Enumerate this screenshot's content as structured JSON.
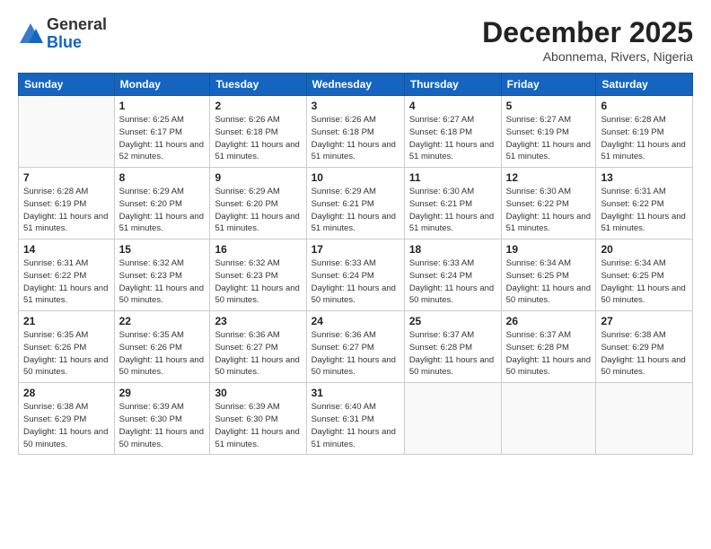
{
  "logo": {
    "general": "General",
    "blue": "Blue"
  },
  "title": "December 2025",
  "subtitle": "Abonnema, Rivers, Nigeria",
  "days_of_week": [
    "Sunday",
    "Monday",
    "Tuesday",
    "Wednesday",
    "Thursday",
    "Friday",
    "Saturday"
  ],
  "weeks": [
    [
      {
        "day": "",
        "sunrise": "",
        "sunset": "",
        "daylight": ""
      },
      {
        "day": "1",
        "sunrise": "Sunrise: 6:25 AM",
        "sunset": "Sunset: 6:17 PM",
        "daylight": "Daylight: 11 hours and 52 minutes."
      },
      {
        "day": "2",
        "sunrise": "Sunrise: 6:26 AM",
        "sunset": "Sunset: 6:18 PM",
        "daylight": "Daylight: 11 hours and 51 minutes."
      },
      {
        "day": "3",
        "sunrise": "Sunrise: 6:26 AM",
        "sunset": "Sunset: 6:18 PM",
        "daylight": "Daylight: 11 hours and 51 minutes."
      },
      {
        "day": "4",
        "sunrise": "Sunrise: 6:27 AM",
        "sunset": "Sunset: 6:18 PM",
        "daylight": "Daylight: 11 hours and 51 minutes."
      },
      {
        "day": "5",
        "sunrise": "Sunrise: 6:27 AM",
        "sunset": "Sunset: 6:19 PM",
        "daylight": "Daylight: 11 hours and 51 minutes."
      },
      {
        "day": "6",
        "sunrise": "Sunrise: 6:28 AM",
        "sunset": "Sunset: 6:19 PM",
        "daylight": "Daylight: 11 hours and 51 minutes."
      }
    ],
    [
      {
        "day": "7",
        "sunrise": "Sunrise: 6:28 AM",
        "sunset": "Sunset: 6:19 PM",
        "daylight": "Daylight: 11 hours and 51 minutes."
      },
      {
        "day": "8",
        "sunrise": "Sunrise: 6:29 AM",
        "sunset": "Sunset: 6:20 PM",
        "daylight": "Daylight: 11 hours and 51 minutes."
      },
      {
        "day": "9",
        "sunrise": "Sunrise: 6:29 AM",
        "sunset": "Sunset: 6:20 PM",
        "daylight": "Daylight: 11 hours and 51 minutes."
      },
      {
        "day": "10",
        "sunrise": "Sunrise: 6:29 AM",
        "sunset": "Sunset: 6:21 PM",
        "daylight": "Daylight: 11 hours and 51 minutes."
      },
      {
        "day": "11",
        "sunrise": "Sunrise: 6:30 AM",
        "sunset": "Sunset: 6:21 PM",
        "daylight": "Daylight: 11 hours and 51 minutes."
      },
      {
        "day": "12",
        "sunrise": "Sunrise: 6:30 AM",
        "sunset": "Sunset: 6:22 PM",
        "daylight": "Daylight: 11 hours and 51 minutes."
      },
      {
        "day": "13",
        "sunrise": "Sunrise: 6:31 AM",
        "sunset": "Sunset: 6:22 PM",
        "daylight": "Daylight: 11 hours and 51 minutes."
      }
    ],
    [
      {
        "day": "14",
        "sunrise": "Sunrise: 6:31 AM",
        "sunset": "Sunset: 6:22 PM",
        "daylight": "Daylight: 11 hours and 51 minutes."
      },
      {
        "day": "15",
        "sunrise": "Sunrise: 6:32 AM",
        "sunset": "Sunset: 6:23 PM",
        "daylight": "Daylight: 11 hours and 50 minutes."
      },
      {
        "day": "16",
        "sunrise": "Sunrise: 6:32 AM",
        "sunset": "Sunset: 6:23 PM",
        "daylight": "Daylight: 11 hours and 50 minutes."
      },
      {
        "day": "17",
        "sunrise": "Sunrise: 6:33 AM",
        "sunset": "Sunset: 6:24 PM",
        "daylight": "Daylight: 11 hours and 50 minutes."
      },
      {
        "day": "18",
        "sunrise": "Sunrise: 6:33 AM",
        "sunset": "Sunset: 6:24 PM",
        "daylight": "Daylight: 11 hours and 50 minutes."
      },
      {
        "day": "19",
        "sunrise": "Sunrise: 6:34 AM",
        "sunset": "Sunset: 6:25 PM",
        "daylight": "Daylight: 11 hours and 50 minutes."
      },
      {
        "day": "20",
        "sunrise": "Sunrise: 6:34 AM",
        "sunset": "Sunset: 6:25 PM",
        "daylight": "Daylight: 11 hours and 50 minutes."
      }
    ],
    [
      {
        "day": "21",
        "sunrise": "Sunrise: 6:35 AM",
        "sunset": "Sunset: 6:26 PM",
        "daylight": "Daylight: 11 hours and 50 minutes."
      },
      {
        "day": "22",
        "sunrise": "Sunrise: 6:35 AM",
        "sunset": "Sunset: 6:26 PM",
        "daylight": "Daylight: 11 hours and 50 minutes."
      },
      {
        "day": "23",
        "sunrise": "Sunrise: 6:36 AM",
        "sunset": "Sunset: 6:27 PM",
        "daylight": "Daylight: 11 hours and 50 minutes."
      },
      {
        "day": "24",
        "sunrise": "Sunrise: 6:36 AM",
        "sunset": "Sunset: 6:27 PM",
        "daylight": "Daylight: 11 hours and 50 minutes."
      },
      {
        "day": "25",
        "sunrise": "Sunrise: 6:37 AM",
        "sunset": "Sunset: 6:28 PM",
        "daylight": "Daylight: 11 hours and 50 minutes."
      },
      {
        "day": "26",
        "sunrise": "Sunrise: 6:37 AM",
        "sunset": "Sunset: 6:28 PM",
        "daylight": "Daylight: 11 hours and 50 minutes."
      },
      {
        "day": "27",
        "sunrise": "Sunrise: 6:38 AM",
        "sunset": "Sunset: 6:29 PM",
        "daylight": "Daylight: 11 hours and 50 minutes."
      }
    ],
    [
      {
        "day": "28",
        "sunrise": "Sunrise: 6:38 AM",
        "sunset": "Sunset: 6:29 PM",
        "daylight": "Daylight: 11 hours and 50 minutes."
      },
      {
        "day": "29",
        "sunrise": "Sunrise: 6:39 AM",
        "sunset": "Sunset: 6:30 PM",
        "daylight": "Daylight: 11 hours and 50 minutes."
      },
      {
        "day": "30",
        "sunrise": "Sunrise: 6:39 AM",
        "sunset": "Sunset: 6:30 PM",
        "daylight": "Daylight: 11 hours and 51 minutes."
      },
      {
        "day": "31",
        "sunrise": "Sunrise: 6:40 AM",
        "sunset": "Sunset: 6:31 PM",
        "daylight": "Daylight: 11 hours and 51 minutes."
      },
      {
        "day": "",
        "sunrise": "",
        "sunset": "",
        "daylight": ""
      },
      {
        "day": "",
        "sunrise": "",
        "sunset": "",
        "daylight": ""
      },
      {
        "day": "",
        "sunrise": "",
        "sunset": "",
        "daylight": ""
      }
    ]
  ]
}
